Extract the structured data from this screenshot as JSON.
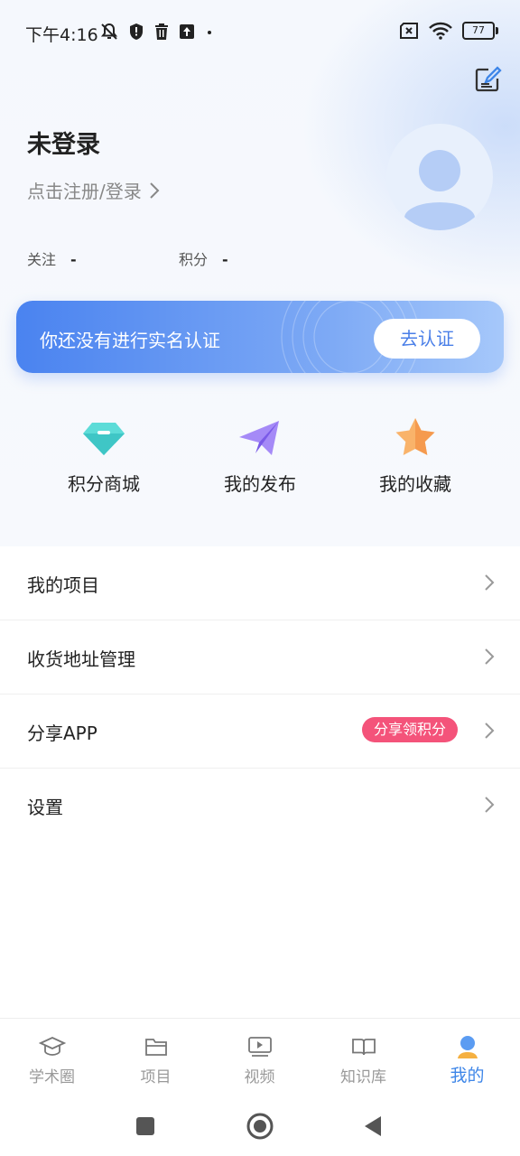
{
  "status_bar": {
    "time": "下午4:16",
    "battery": "77"
  },
  "profile": {
    "name": "未登录",
    "login_prompt": "点击注册/登录",
    "stats": [
      {
        "label": "关注",
        "value": "-"
      },
      {
        "label": "积分",
        "value": "-"
      }
    ]
  },
  "verify": {
    "text": "你还没有进行实名认证",
    "button": "去认证"
  },
  "quick_actions": [
    {
      "label": "积分商城",
      "icon": "diamond-icon",
      "color": "#4fd6d6"
    },
    {
      "label": "我的发布",
      "icon": "paper-plane-icon",
      "color": "#8b6cf0"
    },
    {
      "label": "我的收藏",
      "icon": "star-icon",
      "color": "#f7a65a"
    }
  ],
  "menu": [
    {
      "label": "我的项目"
    },
    {
      "label": "收货地址管理"
    },
    {
      "label": "分享APP",
      "badge": "分享领积分"
    },
    {
      "label": "设置"
    }
  ],
  "tabs": [
    {
      "label": "学术圈",
      "icon": "graduation-cap-icon"
    },
    {
      "label": "项目",
      "icon": "folder-icon"
    },
    {
      "label": "视频",
      "icon": "video-icon"
    },
    {
      "label": "知识库",
      "icon": "book-icon"
    },
    {
      "label": "我的",
      "icon": "user-icon",
      "active": true
    }
  ],
  "colors": {
    "accent": "#3e86e8",
    "badge": "#f4537a",
    "banner_start": "#4a83f0"
  }
}
